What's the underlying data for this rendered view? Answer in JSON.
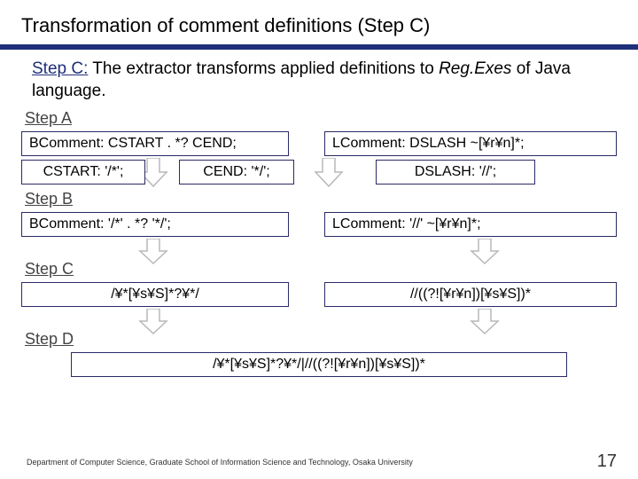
{
  "title": "Transformation of comment definitions (Step C)",
  "subtitle_stepC": "Step C:",
  "subtitle_rest1": " The extractor transforms applied definitions to ",
  "subtitle_regex": "Reg.Exes",
  "subtitle_rest2": " of Java language.",
  "stepA": {
    "label": "Step A",
    "bcomment": "BComment: CSTART . *? CEND;",
    "lcomment": "LComment: DSLASH ~[¥r¥n]*;",
    "cstart": "CSTART: '/*';",
    "cend": "CEND: '*/';",
    "dslash": "DSLASH: '//';"
  },
  "stepB": {
    "label": "Step B",
    "bcomment": "BComment: '/*' . *? '*/';",
    "lcomment": "LComment: '//' ~[¥r¥n]*;"
  },
  "stepC_section": {
    "label": "Step C",
    "left": "/¥*[¥s¥S]*?¥*/",
    "right": "//((?![¥r¥n])[¥s¥S])*"
  },
  "stepD": {
    "label": "Step D",
    "combined": "/¥*[¥s¥S]*?¥*/|//((?![¥r¥n])[¥s¥S])*"
  },
  "footer": "Department of Computer Science, Graduate School of Information Science and Technology, Osaka University",
  "page": "17"
}
